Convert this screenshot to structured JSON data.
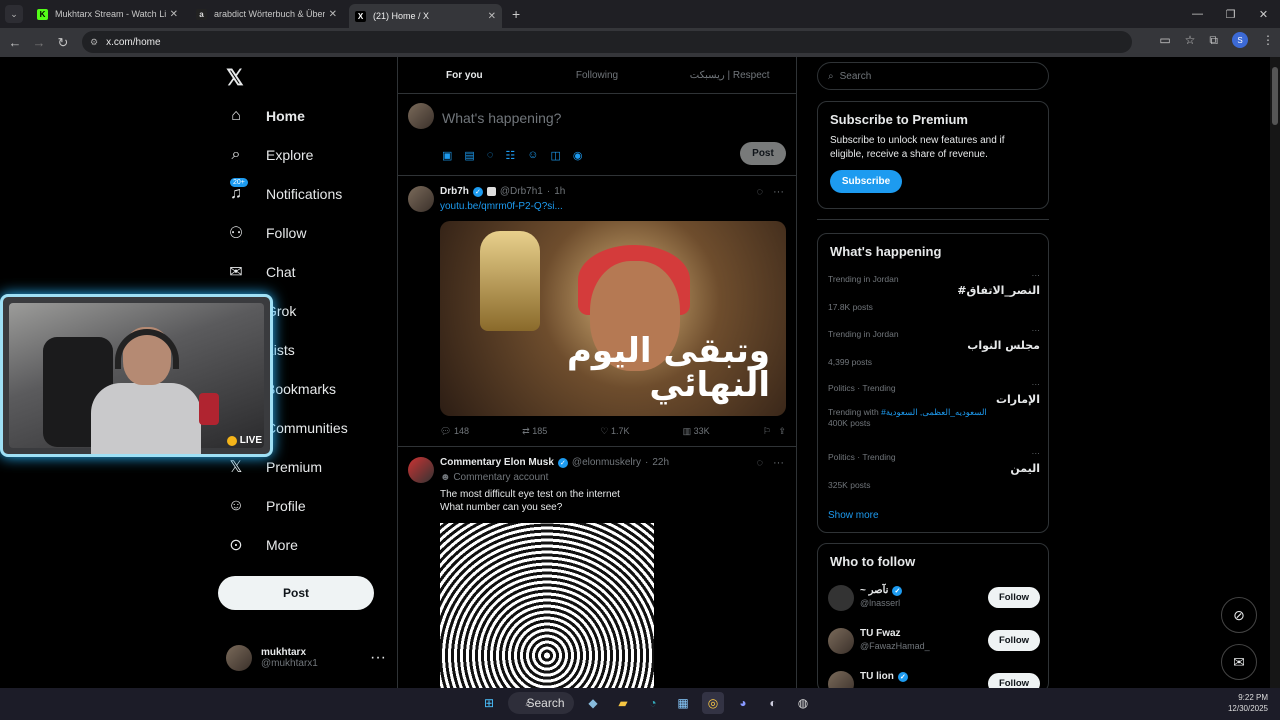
{
  "browser": {
    "tabs": [
      {
        "title": "Mukhtarx Stream - Watch Live on...",
        "fav": "K",
        "fav_color": "#53fc18"
      },
      {
        "title": "arabdict Wörterbuch & Übersetzung",
        "fav": "a",
        "fav_color": "#222222"
      },
      {
        "title": "(21) Home / X",
        "fav": "X",
        "fav_color": "#000000"
      }
    ],
    "url": "x.com/home",
    "profile_letter": "S"
  },
  "nav": {
    "items": [
      {
        "label": "Home",
        "icon": "home-icon",
        "glyph": "⌂"
      },
      {
        "label": "Explore",
        "icon": "search-icon",
        "glyph": "⌕"
      },
      {
        "label": "Notifications",
        "icon": "bell-icon",
        "glyph": "♫"
      },
      {
        "label": "Follow",
        "icon": "person-add-icon",
        "glyph": "⚇"
      },
      {
        "label": "Chat",
        "icon": "mail-icon",
        "glyph": "✉"
      },
      {
        "label": "Grok",
        "icon": "grok-icon",
        "glyph": "◩"
      },
      {
        "label": "Lists",
        "icon": "list-icon",
        "glyph": "☰"
      },
      {
        "label": "Bookmarks",
        "icon": "bookmark-icon",
        "glyph": "⚐"
      },
      {
        "label": "Communities",
        "icon": "communities-icon",
        "glyph": "⚉"
      },
      {
        "label": "Premium",
        "icon": "x-logo-icon",
        "glyph": "𝕏"
      },
      {
        "label": "Profile",
        "icon": "profile-icon",
        "glyph": "☺"
      },
      {
        "label": "More",
        "icon": "more-circle-icon",
        "glyph": "⊙"
      }
    ],
    "notif_badge": "20+",
    "post_label": "Post",
    "account": {
      "name": "mukhtarx",
      "handle": "@mukhtarx1"
    }
  },
  "cam": {
    "live_label": "LIVE"
  },
  "timeline": {
    "tabs": [
      "For you",
      "Following",
      "ريسبكت | Respect"
    ],
    "compose_placeholder": "What's happening?",
    "compose_post": "Post",
    "tweets": [
      {
        "name": "Drb7h",
        "handle": "@Drb7h1",
        "time": "1h",
        "link": "youtu.be/qmrm0f-P2-Q?si...",
        "media_text": "وتبقى اليوم النهائي",
        "stats": {
          "replies": "148",
          "reposts": "185",
          "likes": "1.7K",
          "views": "33K"
        }
      },
      {
        "name": "Commentary Elon Musk",
        "handle": "@elonmuskelry",
        "time": "22h",
        "badge": "Commentary account",
        "line1": "The most difficult eye test on the internet",
        "line2": "What number can you see?"
      }
    ]
  },
  "right": {
    "search_placeholder": "Search",
    "premium": {
      "title": "Subscribe to Premium",
      "text": "Subscribe to unlock new features and if eligible, receive a share of revenue.",
      "button": "Subscribe"
    },
    "happening_title": "What's happening",
    "trends": [
      {
        "context": "Trending in Jordan",
        "topic": "#النصر_الاتفاق",
        "count": "17.8K posts"
      },
      {
        "context": "Trending in Jordan",
        "topic": "مجلس النواب",
        "count": "4,399 posts"
      },
      {
        "context": "Politics · Trending",
        "topic": "الإمارات",
        "with_label": "Trending with",
        "with_tag": "#السعوديه_العظمى, السعودية",
        "count": "400K posts"
      },
      {
        "context": "Politics · Trending",
        "topic": "اليمن",
        "count": "325K posts"
      }
    ],
    "show_more": "Show more",
    "who_to_follow": "Who to follow",
    "people": [
      {
        "name": "~ نآصر",
        "handle": "@lnasserl",
        "follow": "Follow"
      },
      {
        "name": "TU Fwaz",
        "handle": "@FawazHamad_",
        "follow": "Follow"
      },
      {
        "name": "TU lion",
        "handle": "",
        "follow": "Follow"
      }
    ]
  },
  "taskbar": {
    "search": "Search",
    "time": "9:22 PM",
    "date": "12/30/2025"
  }
}
